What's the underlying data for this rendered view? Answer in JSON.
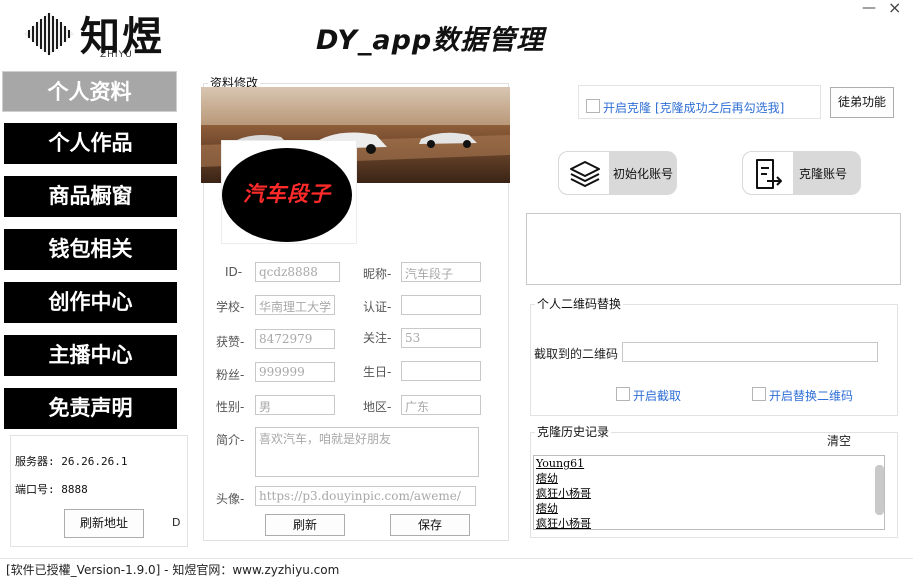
{
  "logo": {
    "cn": "知煜",
    "en": "ZHIYU"
  },
  "app_title": "DY_app数据管理",
  "window": {
    "close": "×",
    "minimize": "—"
  },
  "nav": [
    {
      "label": "个人资料",
      "active": true
    },
    {
      "label": "个人作品"
    },
    {
      "label": "商品橱窗"
    },
    {
      "label": "钱包相关"
    },
    {
      "label": "创作中心"
    },
    {
      "label": "主播中心"
    },
    {
      "label": "免责声明"
    }
  ],
  "server": {
    "server_line": "服务器: 26.26.26.1",
    "port_line": "端口号: 8888",
    "refresh_label": "刷新地址",
    "side_letter": "D"
  },
  "profile": {
    "group_title": "资料修改",
    "avatar_text": "汽车段子",
    "fields": {
      "id": {
        "label": "ID-",
        "value": "qcdz8888"
      },
      "nickname": {
        "label": "昵称-",
        "value": "汽车段子"
      },
      "school": {
        "label": "学校-",
        "value": "华南理工大学"
      },
      "verify": {
        "label": "认证-",
        "value": ""
      },
      "likes": {
        "label": "获赞-",
        "value": "8472979"
      },
      "following": {
        "label": "关注-",
        "value": "53"
      },
      "fans": {
        "label": "粉丝-",
        "value": "999999"
      },
      "birthday": {
        "label": "生日-",
        "value": ""
      },
      "gender": {
        "label": "性别-",
        "value": "男"
      },
      "region": {
        "label": "地区-",
        "value": "广东"
      },
      "bio": {
        "label": "简介-",
        "value": "喜欢汽车，咱就是好朋友"
      },
      "avatar_url": {
        "label": "头像-",
        "value": "https://p3.douyinpic.com/aweme/"
      }
    },
    "refresh_label": "刷新",
    "save_label": "保存"
  },
  "clone": {
    "checkbox_label": "开启克隆",
    "hint": "[克隆成功之后再勾选我]",
    "apprentice_label": "徒弟功能",
    "init_label": "初始化账号",
    "clone_label": "克隆账号",
    "log": ""
  },
  "qr": {
    "group_title": "个人二维码替换",
    "captured_label": "截取到的二维码",
    "captured_value": "",
    "enable_capture": "开启截取",
    "enable_replace": "开启替换二维码"
  },
  "history": {
    "group_title": "克隆历史记录",
    "clear_label": "清空",
    "items": [
      "Young61",
      "痞幼",
      "疯狂小杨哥",
      "痞幼",
      "疯狂小杨哥"
    ]
  },
  "status_bar": "[软件已授權_Version-1.9.0] - 知煜官网：www.zyzhiyu.com",
  "colors": {
    "nav_bg": "#000000",
    "nav_active": "#a7a7a7",
    "link_blue": "#2f6fd6",
    "avatar_text": "#ff2a2a"
  }
}
